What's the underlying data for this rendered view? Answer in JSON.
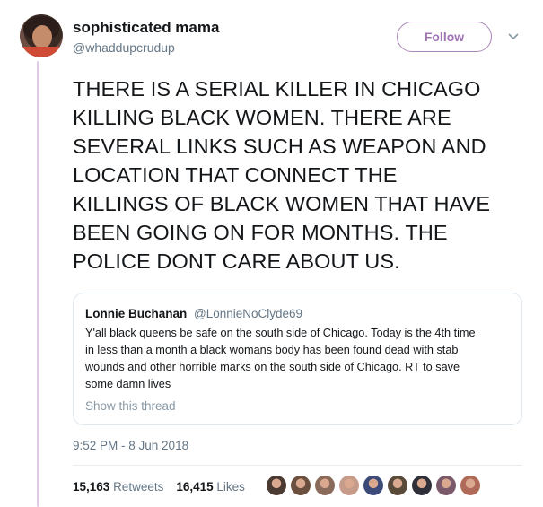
{
  "author": {
    "name": "sophisticated mama",
    "handle": "@whaddupcrudup"
  },
  "follow_button": "Follow",
  "tweet": {
    "lines": [
      "THERE IS A SERIAL KILLER IN CHICAGO",
      "KILLING BLACK WOMEN. THERE ARE",
      "SEVERAL LINKS SUCH AS WEAPON AND",
      "LOCATION THAT CONNECT THE",
      "KILLINGS OF BLACK WOMEN THAT HAVE",
      "BEEN GOING ON FOR MONTHS. THE",
      "POLICE DONT CARE ABOUT US."
    ]
  },
  "quoted": {
    "name": "Lonnie Buchanan",
    "handle": "@LonnieNoClyde69",
    "lines": [
      "Y'all black queens be safe on the south side of Chicago. Today is the 4th time",
      "in less than a month a black womans body has been found dead with stab",
      "wounds and other horrible marks on the south side of Chicago. RT to save",
      "some damn lives"
    ],
    "show_thread": "Show this thread"
  },
  "timestamp": "9:52 PM - 8 Jun 2018",
  "stats": {
    "retweets_count": "15,163",
    "retweets_label": "Retweets",
    "likes_count": "16,415",
    "likes_label": "Likes"
  },
  "likers": [
    "#4a3a32",
    "#6b4f3f",
    "#8a6a5a",
    "#c79b8a",
    "#3c4a7a",
    "#5a4a3a",
    "#2f2f3a",
    "#7a5a6a",
    "#b06a5a"
  ],
  "colors": {
    "accent": "#9f73b4",
    "thread_line": "#e1cce8"
  }
}
